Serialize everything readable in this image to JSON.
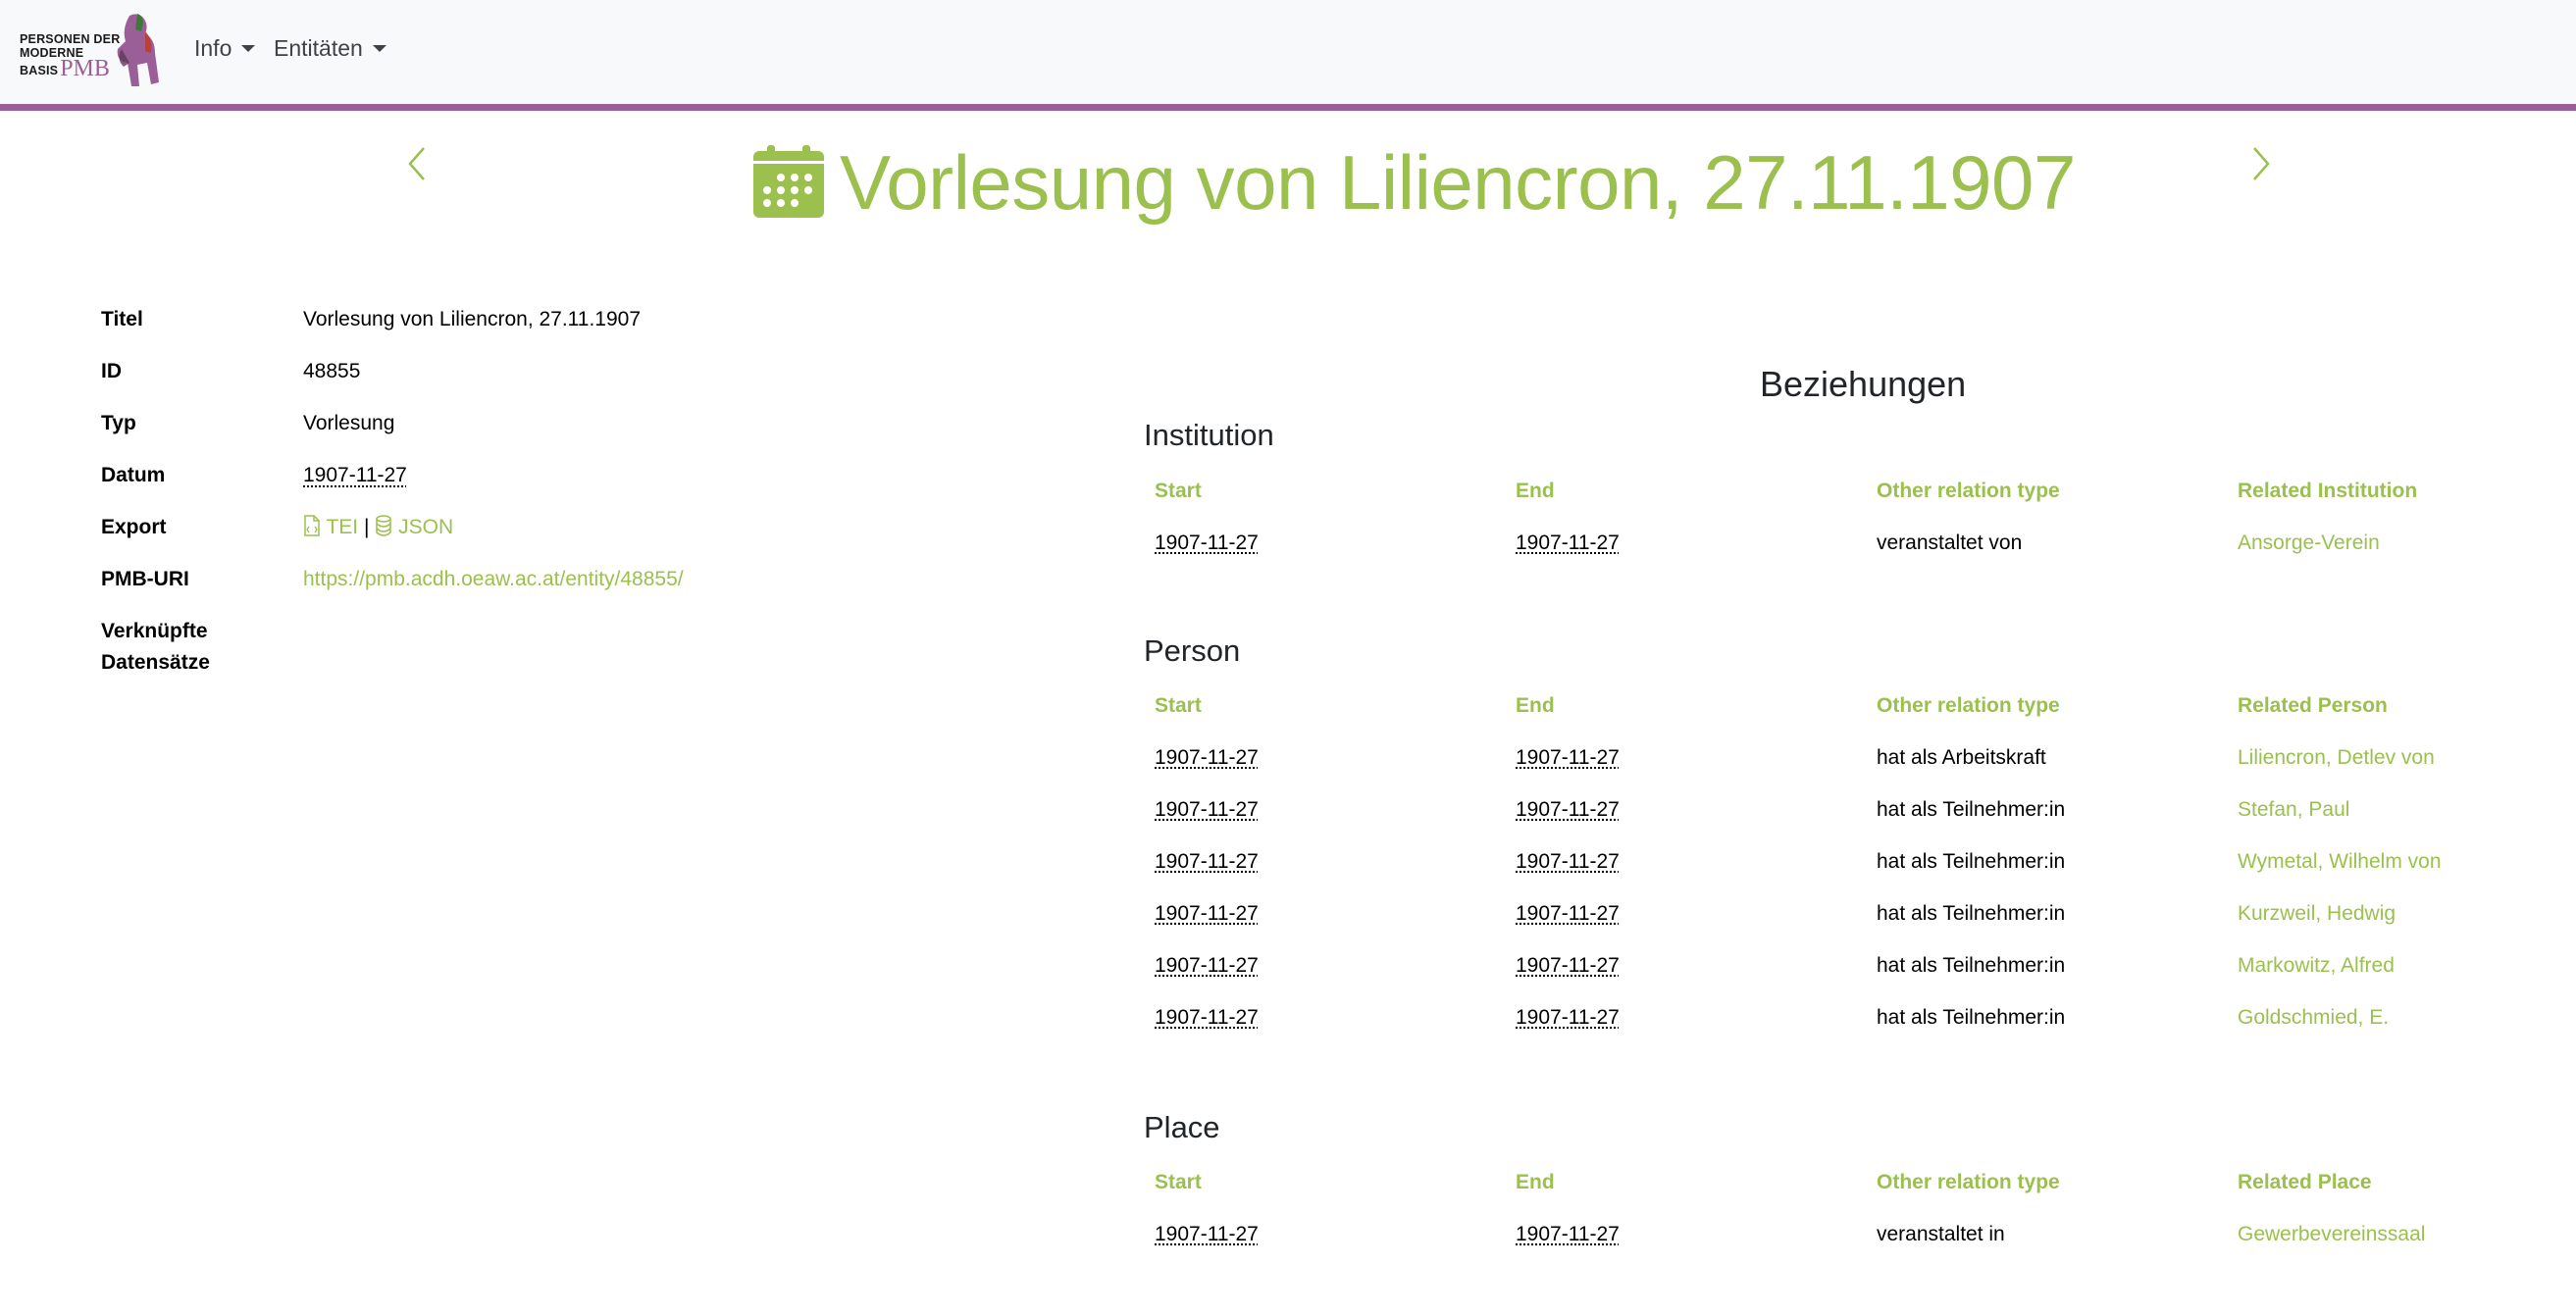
{
  "brand": {
    "line1": "PERSONEN DER",
    "line2": "MODERNE",
    "line3": "BASIS",
    "pmb": "PMB"
  },
  "nav": {
    "info_label": "Info",
    "entities_label": "Entitäten"
  },
  "colors": {
    "accent_green": "#9bc04e",
    "brand_purple": "#9b5f98",
    "navbar_bg": "#f8f9fa"
  },
  "page": {
    "title": "Vorlesung von Liliencron, 27.11.1907",
    "title_icon": "calendar-icon",
    "prev_icon": "chevron-left-icon",
    "next_icon": "chevron-right-icon"
  },
  "properties": {
    "titel_label": "Titel",
    "titel_value": "Vorlesung von Liliencron, 27.11.1907",
    "id_label": "ID",
    "id_value": "48855",
    "typ_label": "Typ",
    "typ_value": "Vorlesung",
    "datum_label": "Datum",
    "datum_value": "1907-11-27",
    "export_label": "Export",
    "export_tei": "TEI",
    "export_sep": "|",
    "export_json": "JSON",
    "uri_label": "PMB-URI",
    "uri_value": "https://pmb.acdh.oeaw.ac.at/entity/48855/",
    "linked_label_1": "Verknüpfte",
    "linked_label_2": "Datensätze"
  },
  "relations": {
    "heading": "Beziehungen",
    "institution": {
      "title": "Institution",
      "headers": [
        "Start",
        "End",
        "Other relation type",
        "Related Institution"
      ],
      "rows": [
        [
          "1907-11-27",
          "1907-11-27",
          "veranstaltet von",
          "Ansorge-Verein"
        ]
      ]
    },
    "person": {
      "title": "Person",
      "headers": [
        "Start",
        "End",
        "Other relation type",
        "Related Person"
      ],
      "rows": [
        [
          "1907-11-27",
          "1907-11-27",
          "hat als Arbeitskraft",
          "Liliencron, Detlev von"
        ],
        [
          "1907-11-27",
          "1907-11-27",
          "hat als Teilnehmer:in",
          "Stefan, Paul"
        ],
        [
          "1907-11-27",
          "1907-11-27",
          "hat als Teilnehmer:in",
          "Wymetal, Wilhelm von"
        ],
        [
          "1907-11-27",
          "1907-11-27",
          "hat als Teilnehmer:in",
          "Kurzweil, Hedwig"
        ],
        [
          "1907-11-27",
          "1907-11-27",
          "hat als Teilnehmer:in",
          "Markowitz, Alfred"
        ],
        [
          "1907-11-27",
          "1907-11-27",
          "hat als Teilnehmer:in",
          "Goldschmied, E."
        ]
      ]
    },
    "place": {
      "title": "Place",
      "headers": [
        "Start",
        "End",
        "Other relation type",
        "Related Place"
      ],
      "rows": [
        [
          "1907-11-27",
          "1907-11-27",
          "veranstaltet in",
          "Gewerbevereinssaal"
        ]
      ]
    }
  }
}
